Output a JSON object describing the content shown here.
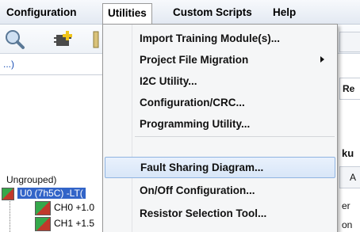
{
  "menubar": {
    "items": [
      "Configuration",
      "Utilities",
      "Custom Scripts",
      "Help"
    ]
  },
  "toolbar": {
    "icons": [
      "search-icon",
      "module-add-icon",
      "toolbar-icon"
    ]
  },
  "background": {
    "link_text": "...)",
    "group_label": "Ungrouped)",
    "tree": [
      {
        "label": "U0 (7h5C) -LT(",
        "selected": true
      },
      {
        "label": "CH0 +1.0",
        "selected": false
      },
      {
        "label": "CH1 +1.5",
        "selected": false
      }
    ],
    "right_fragments": [
      "Re",
      "ku",
      "A",
      "er",
      "on"
    ]
  },
  "dropdown": {
    "items": [
      {
        "label": "Import Training Module(s)...",
        "submenu": false
      },
      {
        "label": "Project File Migration",
        "submenu": true
      },
      {
        "label": "I2C Utility...",
        "submenu": false
      },
      {
        "label": "Configuration/CRC...",
        "submenu": false
      },
      {
        "label": "Programming Utility...",
        "submenu": false
      },
      {
        "label": "Fault Sharing Diagram...",
        "submenu": false,
        "highlighted": true
      },
      {
        "label": "On/Off Configuration...",
        "submenu": false
      },
      {
        "label": "Resistor Selection Tool...",
        "submenu": false
      }
    ]
  },
  "colors": {
    "highlight_bg": "#d8e6f8",
    "highlight_border": "#8fb4e2",
    "selection": "#3264c8"
  }
}
